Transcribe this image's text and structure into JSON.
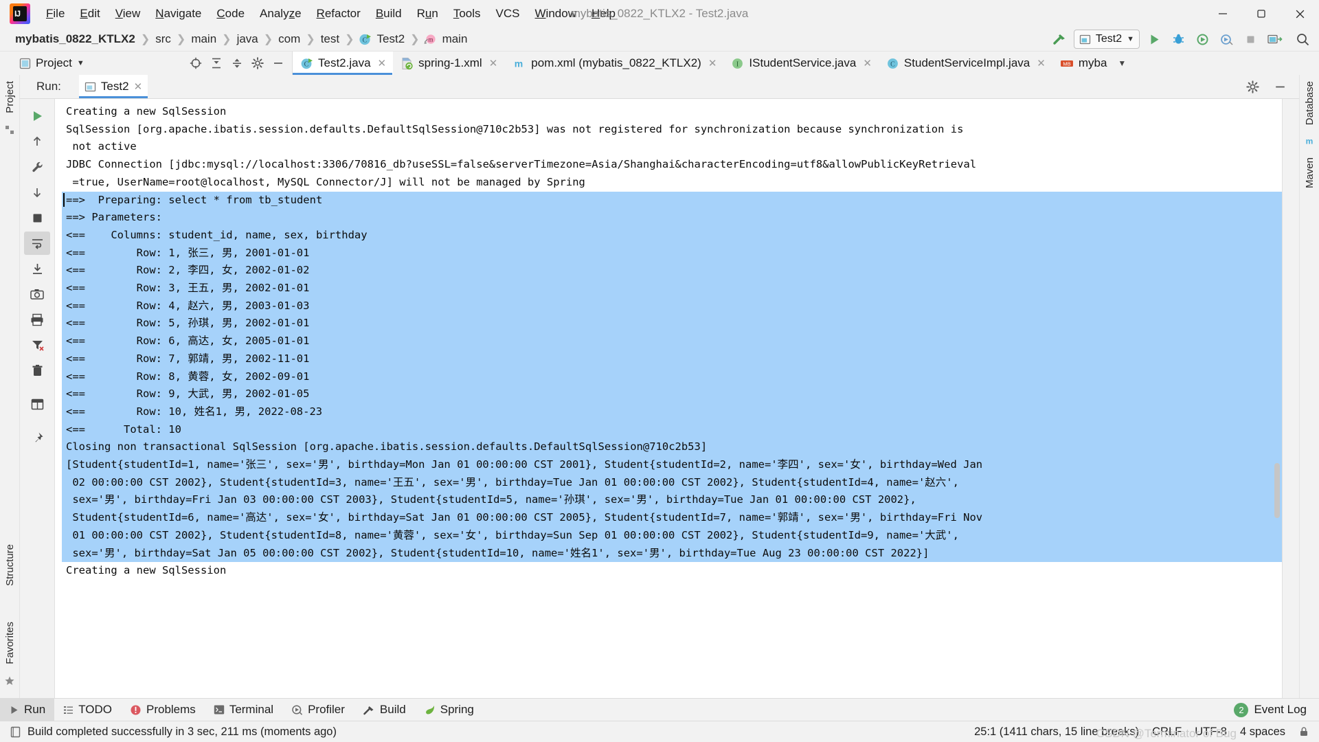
{
  "window": {
    "title": "mybatis_0822_KTLX2 - Test2.java",
    "minimize": "─",
    "maximize": "❐",
    "close": "✕"
  },
  "menu": {
    "items": [
      {
        "label": "File",
        "mnemonic": "F"
      },
      {
        "label": "Edit",
        "mnemonic": "E"
      },
      {
        "label": "View",
        "mnemonic": "V"
      },
      {
        "label": "Navigate",
        "mnemonic": "N"
      },
      {
        "label": "Code",
        "mnemonic": "C"
      },
      {
        "label": "Analyze",
        "mnemonic": "z"
      },
      {
        "label": "Refactor",
        "mnemonic": "R"
      },
      {
        "label": "Build",
        "mnemonic": "B"
      },
      {
        "label": "Run",
        "mnemonic": "u"
      },
      {
        "label": "Tools",
        "mnemonic": "T"
      },
      {
        "label": "VCS",
        "mnemonic": ""
      },
      {
        "label": "Window",
        "mnemonic": "W"
      },
      {
        "label": "Help",
        "mnemonic": "H"
      }
    ]
  },
  "breadcrumb": {
    "items": [
      "mybatis_0822_KTLX2",
      "src",
      "main",
      "java",
      "com",
      "test",
      "Test2",
      "main"
    ],
    "separator": "❯"
  },
  "toolbar": {
    "run_config": "Test2",
    "run_button": "run-icon",
    "debug_button": "debug-icon",
    "coverage_button": "coverage-icon",
    "profile_button": "profile-icon",
    "stop_button": "stop-icon",
    "search_button": "search-icon",
    "build_button": "hammer-icon"
  },
  "project_panel": {
    "title": "Project",
    "dropdown": "▾"
  },
  "editor_tabs": [
    {
      "label": "Test2.java",
      "icon": "java-class-run-icon",
      "active": true,
      "closable": true
    },
    {
      "label": "spring-1.xml",
      "icon": "spring-xml-icon",
      "active": false,
      "closable": true
    },
    {
      "label": "pom.xml (mybatis_0822_KTLX2)",
      "icon": "maven-icon",
      "active": false,
      "closable": true
    },
    {
      "label": "IStudentService.java",
      "icon": "java-interface-icon",
      "active": false,
      "closable": true
    },
    {
      "label": "StudentServiceImpl.java",
      "icon": "java-class-icon",
      "active": false,
      "closable": true
    },
    {
      "label": "myba",
      "icon": "mybatis-icon",
      "active": false,
      "closable": false
    }
  ],
  "run_window": {
    "label": "Run:",
    "tab": "Test2",
    "tab_icon": "run-config-icon",
    "settings_icon": "gear-icon",
    "minimize_icon": "minimize-icon",
    "tools": [
      {
        "name": "rerun-button",
        "icon": "play-green"
      },
      {
        "name": "scroll-up-button",
        "icon": "arrow-up"
      },
      {
        "name": "wrench-button",
        "icon": "wrench"
      },
      {
        "name": "scroll-down-button",
        "icon": "arrow-down"
      },
      {
        "name": "stop-button",
        "icon": "square-stop"
      },
      {
        "name": "soft-wrap-button",
        "icon": "wrap-lines"
      },
      {
        "name": "export-button",
        "icon": "import-arrow"
      },
      {
        "name": "camera-button",
        "icon": "camera"
      },
      {
        "name": "print-button",
        "icon": "printer"
      },
      {
        "name": "clear-filter-button",
        "icon": "filter-x"
      },
      {
        "name": "delete-button",
        "icon": "trash"
      },
      {
        "name": "layout-button",
        "icon": "layout"
      },
      {
        "name": "pin-button",
        "icon": "pin"
      }
    ]
  },
  "console": {
    "lines": [
      {
        "text": "Creating a new SqlSession",
        "selected": false
      },
      {
        "text": "SqlSession [org.apache.ibatis.session.defaults.DefaultSqlSession@710c2b53] was not registered for synchronization because synchronization is",
        "selected": false
      },
      {
        "text": " not active",
        "selected": false
      },
      {
        "text": "JDBC Connection [jdbc:mysql://localhost:3306/70816_db?useSSL=false&serverTimezone=Asia/Shanghai&characterEncoding=utf8&allowPublicKeyRetrieval",
        "selected": false
      },
      {
        "text": " =true, UserName=root@localhost, MySQL Connector/J] will not be managed by Spring",
        "selected": false
      },
      {
        "text": "==>  Preparing: select * from tb_student",
        "selected": true,
        "caret": true
      },
      {
        "text": "==> Parameters: ",
        "selected": true
      },
      {
        "text": "<==    Columns: student_id, name, sex, birthday",
        "selected": true
      },
      {
        "text": "<==        Row: 1, 张三, 男, 2001-01-01",
        "selected": true
      },
      {
        "text": "<==        Row: 2, 李四, 女, 2002-01-02",
        "selected": true
      },
      {
        "text": "<==        Row: 3, 王五, 男, 2002-01-01",
        "selected": true
      },
      {
        "text": "<==        Row: 4, 赵六, 男, 2003-01-03",
        "selected": true
      },
      {
        "text": "<==        Row: 5, 孙琪, 男, 2002-01-01",
        "selected": true
      },
      {
        "text": "<==        Row: 6, 高达, 女, 2005-01-01",
        "selected": true
      },
      {
        "text": "<==        Row: 7, 郭靖, 男, 2002-11-01",
        "selected": true
      },
      {
        "text": "<==        Row: 8, 黄蓉, 女, 2002-09-01",
        "selected": true
      },
      {
        "text": "<==        Row: 9, 大武, 男, 2002-01-05",
        "selected": true
      },
      {
        "text": "<==        Row: 10, 姓名1, 男, 2022-08-23",
        "selected": true
      },
      {
        "text": "<==      Total: 10",
        "selected": true
      },
      {
        "text": "Closing non transactional SqlSession [org.apache.ibatis.session.defaults.DefaultSqlSession@710c2b53]",
        "selected": true
      },
      {
        "text": "[Student{studentId=1, name='张三', sex='男', birthday=Mon Jan 01 00:00:00 CST 2001}, Student{studentId=2, name='李四', sex='女', birthday=Wed Jan",
        "selected": true
      },
      {
        "text": " 02 00:00:00 CST 2002}, Student{studentId=3, name='王五', sex='男', birthday=Tue Jan 01 00:00:00 CST 2002}, Student{studentId=4, name='赵六',",
        "selected": true
      },
      {
        "text": " sex='男', birthday=Fri Jan 03 00:00:00 CST 2003}, Student{studentId=5, name='孙琪', sex='男', birthday=Tue Jan 01 00:00:00 CST 2002},",
        "selected": true
      },
      {
        "text": " Student{studentId=6, name='高达', sex='女', birthday=Sat Jan 01 00:00:00 CST 2005}, Student{studentId=7, name='郭靖', sex='男', birthday=Fri Nov",
        "selected": true
      },
      {
        "text": " 01 00:00:00 CST 2002}, Student{studentId=8, name='黄蓉', sex='女', birthday=Sun Sep 01 00:00:00 CST 2002}, Student{studentId=9, name='大武',",
        "selected": true
      },
      {
        "text": " sex='男', birthday=Sat Jan 05 00:00:00 CST 2002}, Student{studentId=10, name='姓名1', sex='男', birthday=Tue Aug 23 00:00:00 CST 2022}]",
        "selected": true
      },
      {
        "text": "Creating a new SqlSession",
        "selected": false
      }
    ],
    "selection_color": "#a6d2fa"
  },
  "left_rail": {
    "items": [
      "Project",
      "Structure",
      "Favorites"
    ]
  },
  "right_rail": {
    "items": [
      "Database",
      "Maven"
    ]
  },
  "bottom_bar": {
    "items": [
      {
        "label": "Run",
        "icon": "play-icon",
        "selected": true
      },
      {
        "label": "TODO",
        "icon": "todo-icon",
        "selected": false
      },
      {
        "label": "Problems",
        "icon": "problems-icon",
        "selected": false
      },
      {
        "label": "Terminal",
        "icon": "terminal-icon",
        "selected": false
      },
      {
        "label": "Profiler",
        "icon": "profiler-icon",
        "selected": false
      },
      {
        "label": "Build",
        "icon": "build-icon",
        "selected": false
      },
      {
        "label": "Spring",
        "icon": "spring-icon",
        "selected": false
      }
    ],
    "event_log": {
      "label": "Event Log",
      "count": "2"
    }
  },
  "status_bar": {
    "message": "Build completed successfully in 3 sec, 211 ms (moments ago)",
    "message_icon": "build-status-icon",
    "caret": "25:1 (1411 chars, 15 line breaks)",
    "line_separator": "CRLF",
    "encoding": "UTF-8",
    "indent": "4 spaces",
    "lock_icon": "lock-icon",
    "watermark": "CSDN @Terminator of Bug"
  },
  "colors": {
    "accent": "#4a90d9",
    "selection": "#a6d2fa",
    "green": "#59a869",
    "chrome": "#f2f2f2"
  }
}
